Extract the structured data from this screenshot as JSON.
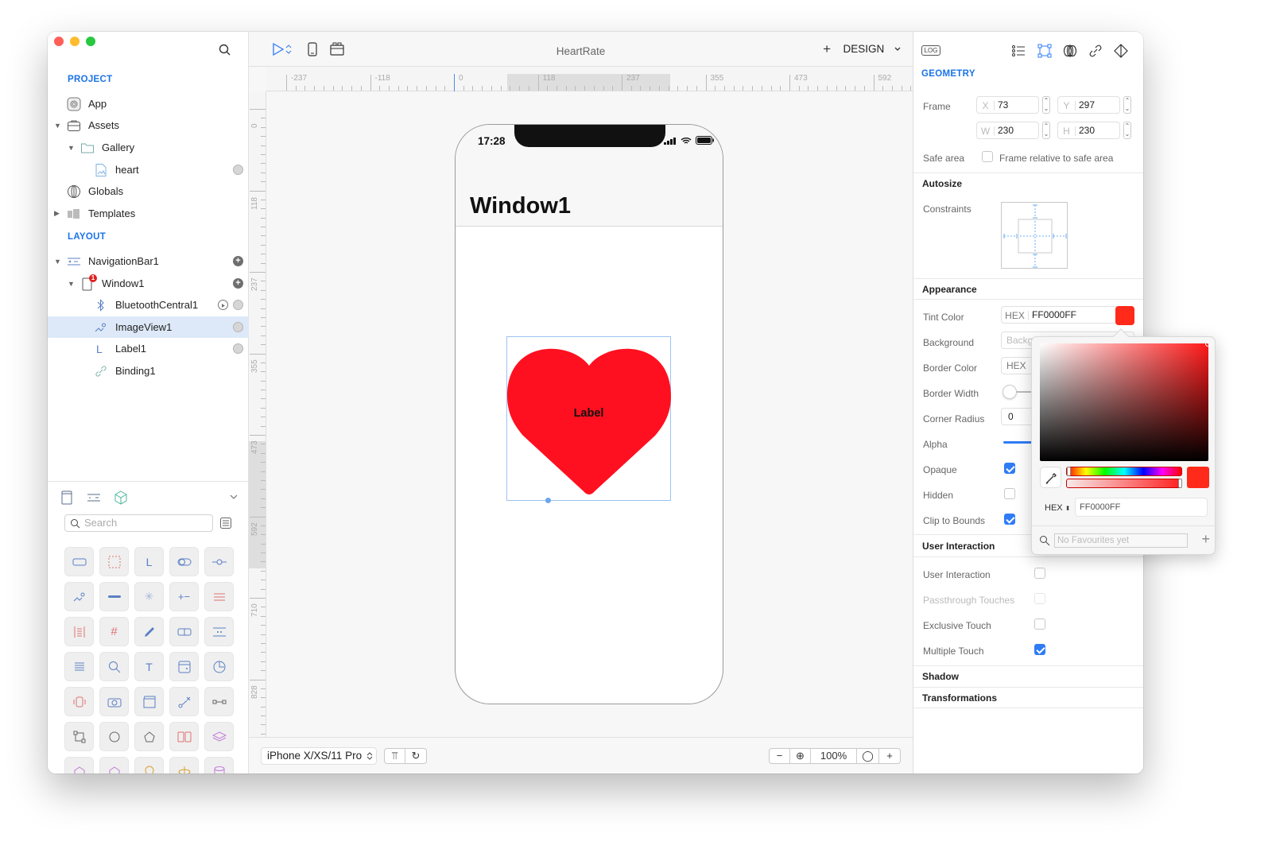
{
  "window": {
    "title": "HeartRate",
    "mode": "DESIGN"
  },
  "sidebar": {
    "project_title": "PROJECT",
    "project_items": [
      {
        "label": "App",
        "icon": "app-icon"
      },
      {
        "label": "Assets",
        "icon": "briefcase-icon",
        "expanded": true
      },
      {
        "label": "Gallery",
        "icon": "folder-icon",
        "expanded": true
      },
      {
        "label": "heart",
        "icon": "image-file-icon"
      },
      {
        "label": "Globals",
        "icon": "globe-icon"
      },
      {
        "label": "Templates",
        "icon": "templates-icon",
        "expanded": false
      }
    ],
    "layout_title": "LAYOUT",
    "layout_items": [
      {
        "label": "NavigationBar1",
        "icon": "navbar-icon"
      },
      {
        "label": "Window1",
        "icon": "window-icon",
        "badge": "1"
      },
      {
        "label": "BluetoothCentral1",
        "icon": "bluetooth-icon"
      },
      {
        "label": "ImageView1",
        "icon": "imageview-icon",
        "selected": true
      },
      {
        "label": "Label1",
        "icon": "label-icon"
      },
      {
        "label": "Binding1",
        "icon": "link-icon"
      }
    ],
    "library": {
      "search_placeholder": "Search"
    }
  },
  "canvas": {
    "ruler_h": [
      "-237",
      "-118",
      "0",
      "118",
      "237",
      "355",
      "473",
      "592"
    ],
    "ruler_v": [
      "0",
      "118",
      "237",
      "355",
      "473",
      "592",
      "710",
      "828"
    ],
    "phone": {
      "time": "17:28",
      "nav_title": "Window1",
      "image_label": "Label",
      "tint": "#ff1020"
    },
    "device": "iPhone X/XS/11 Pro",
    "zoom": "100%"
  },
  "inspector": {
    "geometry_title": "GEOMETRY",
    "log_label": "LOG",
    "frame_label": "Frame",
    "x": "73",
    "y": "297",
    "w": "230",
    "h": "230",
    "safe_area_label": "Safe area",
    "safe_area_option": "Frame relative to safe area",
    "autosize_title": "Autosize",
    "constraints_label": "Constraints",
    "appearance_title": "Appearance",
    "tint_label": "Tint Color",
    "hex_prefix": "HEX",
    "tint_value": "FF0000FF",
    "tint_color": "#ff2a1a",
    "background_label": "Background",
    "background_placeholder": "Background",
    "border_color_label": "Border Color",
    "border_width_label": "Border Width",
    "corner_radius_label": "Corner Radius",
    "corner_radius_value": "0",
    "alpha_label": "Alpha",
    "opaque_label": "Opaque",
    "opaque": true,
    "hidden_label": "Hidden",
    "hidden": false,
    "clip_label": "Clip to Bounds",
    "clip": true,
    "ui_title": "User Interaction",
    "user_interaction_label": "User Interaction",
    "user_interaction": false,
    "passthrough_label": "Passthrough Touches",
    "passthrough": false,
    "exclusive_label": "Exclusive Touch",
    "exclusive": false,
    "multiple_label": "Multiple Touch",
    "multiple": true,
    "shadow_title": "Shadow",
    "transform_title": "Transformations"
  },
  "color_picker": {
    "hex_label": "HEX",
    "hex_value": "FF0000FF",
    "favourites_placeholder": "No Favourites yet",
    "hue_position": 0.0,
    "alpha_position": 1.0
  }
}
